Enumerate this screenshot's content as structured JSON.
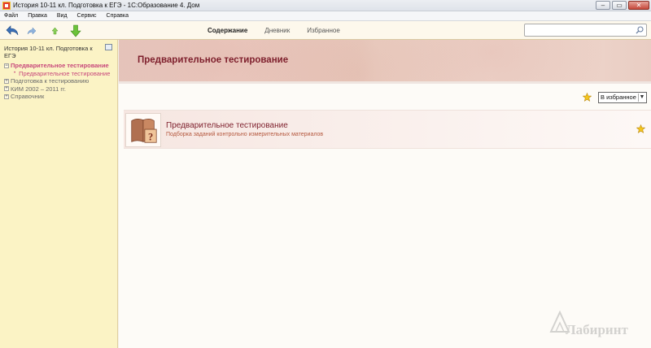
{
  "window": {
    "title": "История 10-11 кл. Подготовка к ЕГЭ - 1С:Образование 4. Дом",
    "minimize": "–",
    "maximize": "▭",
    "close": "✕"
  },
  "menu": [
    "Файл",
    "Правка",
    "Вид",
    "Сервис",
    "Справка"
  ],
  "toolbar": {
    "icons": [
      "back-arrow-icon",
      "forward-arrow-icon",
      "up-arrow-icon",
      "down-arrow-icon"
    ],
    "tabs": [
      {
        "label": "Содержание",
        "active": true
      },
      {
        "label": "Дневник",
        "active": false
      },
      {
        "label": "Избранное",
        "active": false
      }
    ],
    "search_value": ""
  },
  "sidebar": {
    "title": "История 10-11 кл. Подготовка к ЕГЭ",
    "tree": [
      {
        "label": "Предварительное тестирование",
        "expanded": true,
        "active": true
      },
      {
        "label": "Предварительное тестирование",
        "child": true
      },
      {
        "label": "Подготовка к тестированию",
        "expanded": false
      },
      {
        "label": "КИМ 2002 – 2011 гг.",
        "expanded": false
      },
      {
        "label": "Справочник",
        "expanded": false
      }
    ]
  },
  "main": {
    "banner_title": "Предварительное тестирование",
    "favorites_select": "В избранное",
    "card": {
      "title": "Предварительное тестирование",
      "subtitle": "Подборка заданий контрольно измерительных материалов"
    }
  },
  "watermark": "Лабиринт",
  "colors": {
    "sidebar_bg": "#fbf3c5",
    "accent": "#7e1f2c",
    "tree_active": "#c7477b"
  }
}
